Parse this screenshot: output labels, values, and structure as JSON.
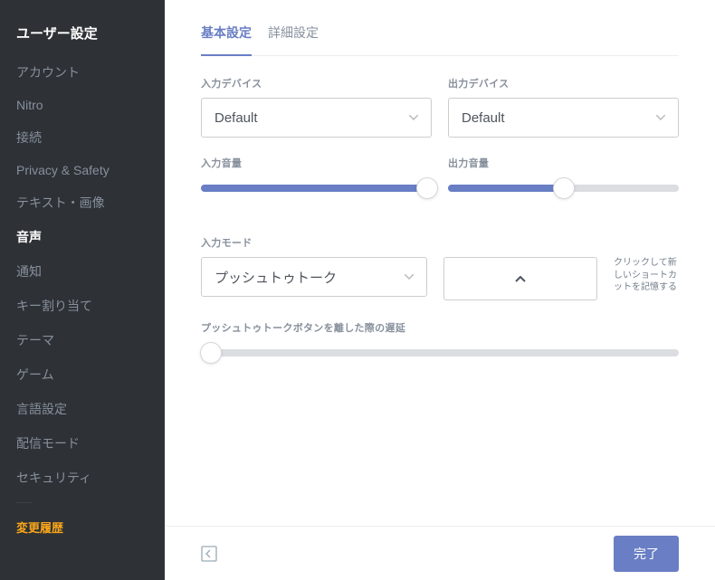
{
  "sidebar": {
    "title": "ユーザー設定",
    "items": [
      {
        "label": "アカウント"
      },
      {
        "label": "Nitro"
      },
      {
        "label": "接続"
      },
      {
        "label": "Privacy & Safety"
      },
      {
        "label": "テキスト・画像"
      },
      {
        "label": "音声",
        "active": true
      },
      {
        "label": "通知"
      },
      {
        "label": "キー割り当て"
      },
      {
        "label": "テーマ"
      },
      {
        "label": "ゲーム"
      },
      {
        "label": "言語設定"
      },
      {
        "label": "配信モード"
      },
      {
        "label": "セキュリティ"
      }
    ],
    "changelog": "変更履歴"
  },
  "tabs": {
    "basic": "基本設定",
    "advanced": "詳細設定"
  },
  "inputDevice": {
    "label": "入力デバイス",
    "value": "Default"
  },
  "outputDevice": {
    "label": "出力デバイス",
    "value": "Default"
  },
  "inputVolume": {
    "label": "入力音量",
    "percent": 98
  },
  "outputVolume": {
    "label": "出力音量",
    "percent": 50
  },
  "inputMode": {
    "label": "入力モード",
    "value": "プッシュトゥトーク"
  },
  "shortcut": {
    "hint": "クリックして新しいショートカットを記憶する"
  },
  "releaseDelay": {
    "label": "プッシュトゥトークボタンを離した際の遅延",
    "percent": 2
  },
  "footer": {
    "done": "完了"
  }
}
